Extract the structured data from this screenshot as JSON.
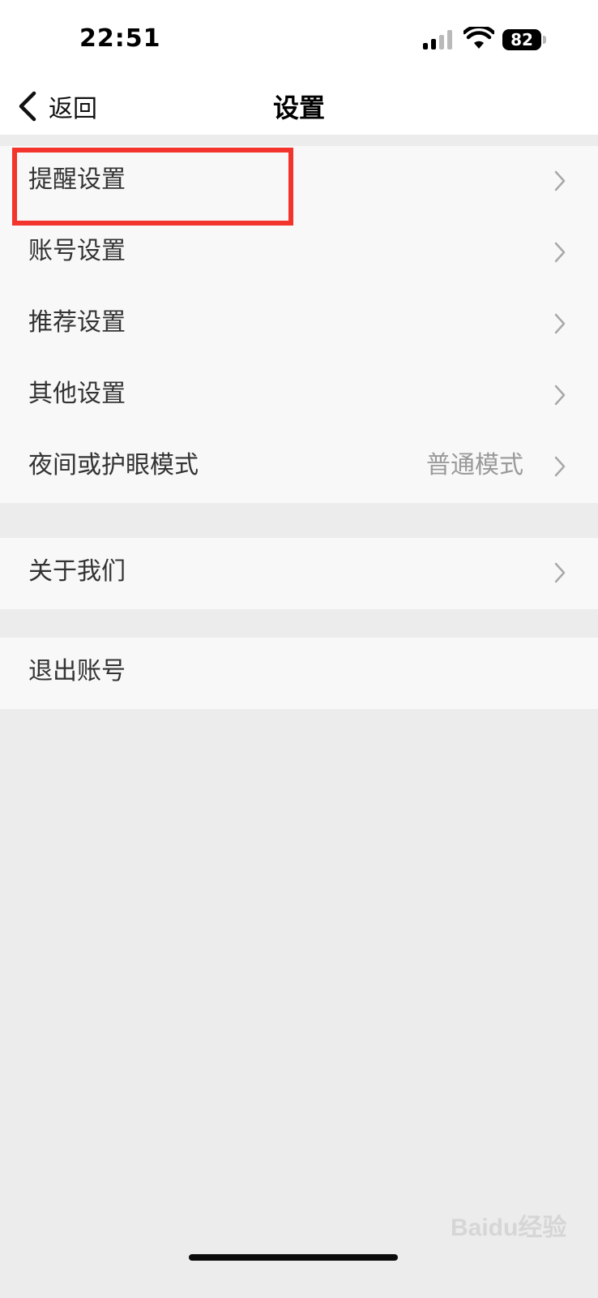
{
  "status_bar": {
    "time": "22:51",
    "battery_level": "82",
    "signal_icon": "cellular-signal-icon",
    "wifi_icon": "wifi-icon"
  },
  "nav": {
    "back_label": "返回",
    "title": "设置"
  },
  "groups": [
    {
      "items": [
        {
          "label": "提醒设置",
          "value": ""
        },
        {
          "label": "账号设置",
          "value": ""
        },
        {
          "label": "推荐设置",
          "value": ""
        },
        {
          "label": "其他设置",
          "value": ""
        },
        {
          "label": "夜间或护眼模式",
          "value": "普通模式"
        }
      ]
    },
    {
      "items": [
        {
          "label": "关于我们",
          "value": ""
        }
      ]
    },
    {
      "items": [
        {
          "label": "退出账号",
          "value": ""
        }
      ]
    }
  ],
  "highlight_color": "#f2342d",
  "watermark": "Baidu经验"
}
